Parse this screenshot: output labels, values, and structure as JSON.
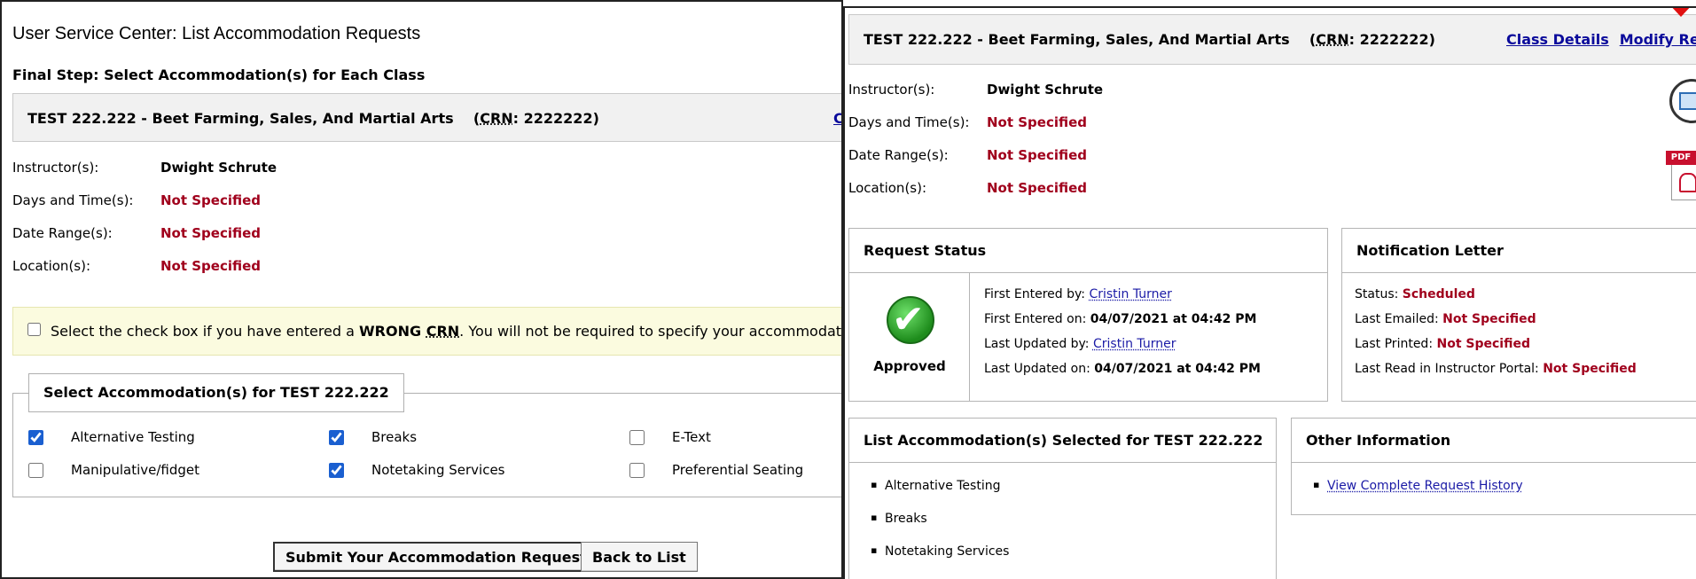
{
  "left": {
    "title": "User Service Center: List Accommodation Requests",
    "step": "Final Step: Select Accommodation(s) for Each Class",
    "class_bar": {
      "name": "TEST 222.222 - Beet Farming, Sales, And Martial Arts",
      "crn_label": "CRN",
      "crn": ": 2222222)",
      "crn_open": "(",
      "cut_link": "Cl"
    },
    "info": [
      {
        "label": "Instructor(s):",
        "value": "Dwight Schrute"
      },
      {
        "label": "Days and Time(s):",
        "value": "Not Specified"
      },
      {
        "label": "Date Range(s):",
        "value": "Not Specified"
      },
      {
        "label": "Location(s):",
        "value": "Not Specified"
      }
    ],
    "notice": {
      "pre": "Select the check box if you have entered a ",
      "strong": "WRONG ",
      "crn": "CRN",
      "post": ". You will not be required to specify your accommodation for this class."
    },
    "accommodations_legend": "Select Accommodation(s) for TEST 222.222",
    "accommodations": [
      {
        "label": "Alternative Testing",
        "checked": true
      },
      {
        "label": "Breaks",
        "checked": true
      },
      {
        "label": "E-Text",
        "checked": false
      },
      {
        "label": "Manipulative/fidget",
        "checked": false
      },
      {
        "label": "Notetaking Services",
        "checked": true
      },
      {
        "label": "Preferential Seating",
        "checked": false
      }
    ],
    "submit_label": "Submit Your Accommodation Requests",
    "back_label": "Back to List"
  },
  "right": {
    "class_bar": {
      "name": "TEST 222.222 - Beet Farming, Sales, And Martial Arts",
      "crn_label": "CRN",
      "crn": ": 2222222)",
      "crn_open": "(",
      "class_details": "Class Details",
      "modify_request": "Modify Request"
    },
    "info": [
      {
        "label": "Instructor(s):",
        "value": "Dwight Schrute"
      },
      {
        "label": "Days and Time(s):",
        "value": "Not Specified"
      },
      {
        "label": "Date Range(s):",
        "value": "Not Specified"
      },
      {
        "label": "Location(s):",
        "value": "Not Specified"
      }
    ],
    "request_status": {
      "title": "Request Status",
      "status": "Approved",
      "first_entered_by_label": "First Entered by: ",
      "first_entered_by": "Cristin Turner",
      "first_entered_on_label": "First Entered on: ",
      "first_entered_on": "04/07/2021 at 04:42 PM",
      "last_updated_by_label": "Last Updated by: ",
      "last_updated_by": "Cristin Turner",
      "last_updated_on_label": "Last Updated on: ",
      "last_updated_on": "04/07/2021 at 04:42 PM"
    },
    "notification_letter": {
      "title": "Notification Letter",
      "status_label": "Status: ",
      "status": "Scheduled",
      "emailed_label": "Last Emailed: ",
      "emailed": "Not Specified",
      "printed_label": "Last Printed: ",
      "printed": "Not Specified",
      "read_label": "Last Read in Instructor Portal: ",
      "read": "Not Specified"
    },
    "selected_accommodations": {
      "title": "List Accommodation(s) Selected for TEST 222.222",
      "items": [
        "Alternative Testing",
        "Breaks",
        "Notetaking Services"
      ]
    },
    "other_information": {
      "title": "Other Information",
      "link": "View Complete Request History"
    },
    "icons": {
      "envelope": "email-icon",
      "pdf": "pdf-icon",
      "pointer": "red-arrow-pointer-icon"
    },
    "icon_text": {
      "pdf_tag": "PDF"
    },
    "colors": {
      "not_specified": "#a0001c",
      "approved_green": "#1e8c1c",
      "pointer": "#e01010"
    }
  }
}
